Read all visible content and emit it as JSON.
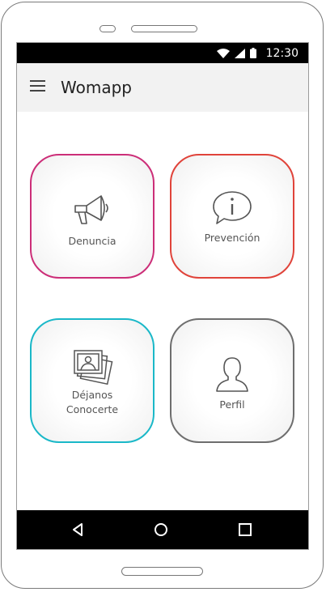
{
  "status_bar": {
    "time": "12:30",
    "icons": [
      "wifi-icon",
      "signal-icon",
      "battery-icon"
    ]
  },
  "app_bar": {
    "title": "Womapp",
    "menu_icon": "hamburger-menu-icon"
  },
  "tiles": [
    {
      "label": "Denuncia",
      "icon": "megaphone-icon",
      "border_color": "#cc2e78"
    },
    {
      "label": "Prevención",
      "icon": "info-bubble-icon",
      "border_color": "#e0433a"
    },
    {
      "label_line1": "Déjanos",
      "label_line2": "Conocerte",
      "icon": "photos-icon",
      "border_color": "#1ab8c8"
    },
    {
      "label": "Perfil",
      "icon": "profile-icon",
      "border_color": "#6e6e6e"
    }
  ],
  "nav_bar": {
    "buttons": [
      "back-icon",
      "home-icon",
      "recents-icon"
    ]
  }
}
